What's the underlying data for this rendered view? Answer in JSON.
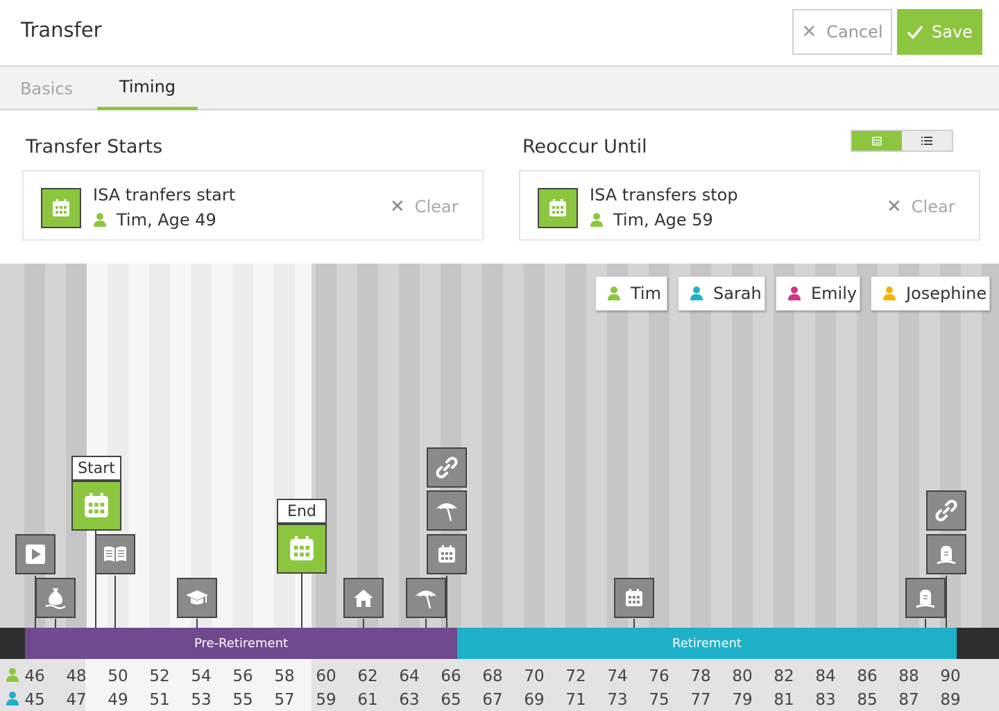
{
  "header": {
    "title": "Transfer",
    "cancel_label": "Cancel",
    "save_label": "Save"
  },
  "tabs": [
    {
      "label": "Basics",
      "active": false
    },
    {
      "label": "Timing",
      "active": true
    }
  ],
  "transfer_starts": {
    "heading": "Transfer Starts",
    "event_name": "ISA tranfers start",
    "person": "Tim, Age 49",
    "clear_label": "Clear"
  },
  "reoccur_until": {
    "heading": "Reoccur Until",
    "event_name": "ISA transfers stop",
    "person": "Tim, Age 59",
    "clear_label": "Clear"
  },
  "view_toggle": {
    "options": [
      "calendar-view",
      "list-view"
    ],
    "selected": "calendar-view"
  },
  "people": [
    {
      "name": "Tim",
      "color": "#8cc63f"
    },
    {
      "name": "Sarah",
      "color": "#1eb0c8"
    },
    {
      "name": "Emily",
      "color": "#d63384"
    },
    {
      "name": "Josephine",
      "color": "#f0b400"
    }
  ],
  "timeline": {
    "start_flag": "Start",
    "end_flag": "End",
    "phases": [
      {
        "label": "Pre-Retirement",
        "color": "#6f4a8e"
      },
      {
        "label": "Retirement",
        "color": "#1eb0c8"
      }
    ],
    "selected_range": {
      "from_age": 49,
      "to_age": 59
    },
    "events": [
      {
        "icon": "play-icon",
        "age": 46
      },
      {
        "icon": "money-bag-icon",
        "age": 47
      },
      {
        "icon": "book-icon",
        "age": 50
      },
      {
        "icon": "graduation-cap-icon",
        "age": 54
      },
      {
        "icon": "house-icon",
        "age": 62
      },
      {
        "icon": "umbrella-icon",
        "age": 65
      },
      {
        "icon": "link-icon",
        "age": 66
      },
      {
        "icon": "umbrella-icon",
        "age": 66
      },
      {
        "icon": "calendar-icon",
        "age": 66
      },
      {
        "icon": "calendar-icon",
        "age": 74
      },
      {
        "icon": "tombstone-icon",
        "age": 89
      },
      {
        "icon": "tombstone-icon",
        "age": 90
      },
      {
        "icon": "link-icon",
        "age": 90
      }
    ],
    "tim_ages": [
      "46",
      "48",
      "50",
      "52",
      "54",
      "56",
      "58",
      "60",
      "62",
      "64",
      "66",
      "68",
      "70",
      "72",
      "74",
      "76",
      "78",
      "80",
      "82",
      "84",
      "86",
      "88",
      "90"
    ],
    "sarah_ages": [
      "45",
      "47",
      "49",
      "51",
      "53",
      "55",
      "57",
      "59",
      "61",
      "63",
      "65",
      "67",
      "69",
      "71",
      "73",
      "75",
      "77",
      "79",
      "81",
      "83",
      "85",
      "87",
      "89"
    ]
  }
}
